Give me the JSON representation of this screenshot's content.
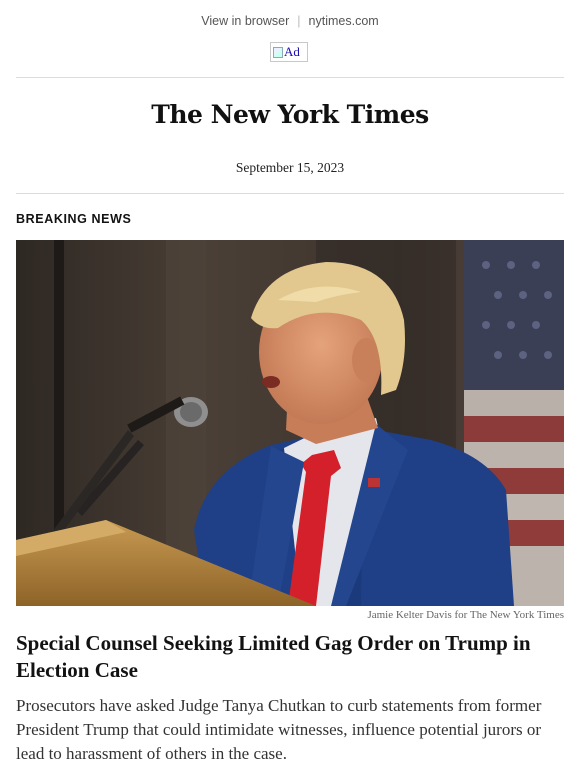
{
  "header": {
    "view_in_browser": "View in browser",
    "separator": "|",
    "site_link": "nytimes.com",
    "ad_alt": "Ad"
  },
  "masthead": {
    "logo_text": "The New York Times",
    "date": "September 15, 2023"
  },
  "article": {
    "kicker": "BREAKING NEWS",
    "photo_credit": "Jamie Kelter Davis for The New York Times",
    "headline": "Special Counsel Seeking Limited Gag Order on Trump in Election Case",
    "summary": "Prosecutors have asked Judge Tanya Chutkan to curb statements from former President Trump that could intimidate witnesses, influence potential jurors or lead to harassment of others in the case."
  },
  "colors": {
    "link": "#1a0dab",
    "rule": "#dcdcdc",
    "suit": "#1f3f86",
    "tie": "#d4202a",
    "podium": "#b0823e"
  }
}
